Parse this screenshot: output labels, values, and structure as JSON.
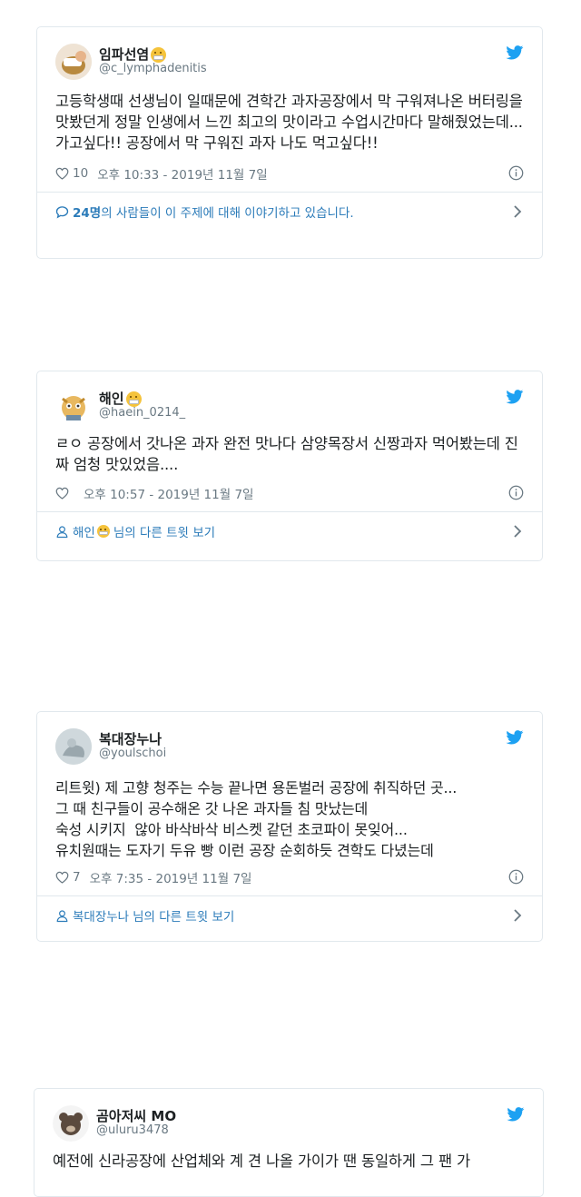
{
  "tweets": [
    {
      "name": "임파선염",
      "handle": "@c_lymphadenitis",
      "text": "고등학생때 선생님이 일때문에 견학간 과자공장에서 막 구워져나온 버터링을 맛봤던게 정말 인생에서 느낀 최고의 맛이라고 수업시간마다 말해줬었는데... 가고싶다!! 공장에서 막 구워진 과자 나도 먹고싶다!!",
      "likes": "10",
      "timestamp": "오후 10:33 - 2019년 11월 7일",
      "footer_count": "24명",
      "footer_text": "의 사람들이 이 주제에 대해 이야기하고 있습니다."
    },
    {
      "name": "해인",
      "handle": "@haein_0214_",
      "text": "ㄹㅇ 공장에서 갓나온 과자 완전 맛나다 삼양목장서 신짱과자 먹어봤는데 진짜 엄청 맛있었음....",
      "likes": "",
      "timestamp": "오후 10:57 - 2019년 11월 7일",
      "footer_name": "해인",
      "footer_text": "님의 다른 트윗 보기"
    },
    {
      "name": "복대장누나",
      "handle": "@youlschoi",
      "text_lines": [
        "리트윗) 제 고향 청주는 수능 끝나면 용돈벌러 공장에 취직하던 곳...",
        "그 때 친구들이 공수해온 갓 나온 과자들 침 맛났는데",
        "숙성 시키지  않아 바삭바삭 비스켓 같던 초코파이 못잊어...",
        "유치원때는 도자기 두유 빵 이런 공장 순회하듯 견학도 다녔는데"
      ],
      "likes": "7",
      "timestamp": "오후 7:35 - 2019년 11월 7일",
      "footer_name": "복대장누나",
      "footer_text": "님의 다른 트윗 보기"
    },
    {
      "name": "곰아저씨 MO",
      "handle": "@uluru3478",
      "text": "예전에 신라공장에 산업체와 계 견 나올 가이가 땐 동일하게 그 팬 가"
    }
  ],
  "colors": {
    "twitter_blue": "#1da1f2",
    "link_blue": "#2b7bb9",
    "meta_gray": "#697882",
    "border": "#e1e8ed"
  },
  "icons": [
    "twitter-bird-icon",
    "heart-icon",
    "info-icon",
    "speech-bubble-icon",
    "person-icon",
    "chevron-right-icon",
    "face-mask-emoji"
  ]
}
